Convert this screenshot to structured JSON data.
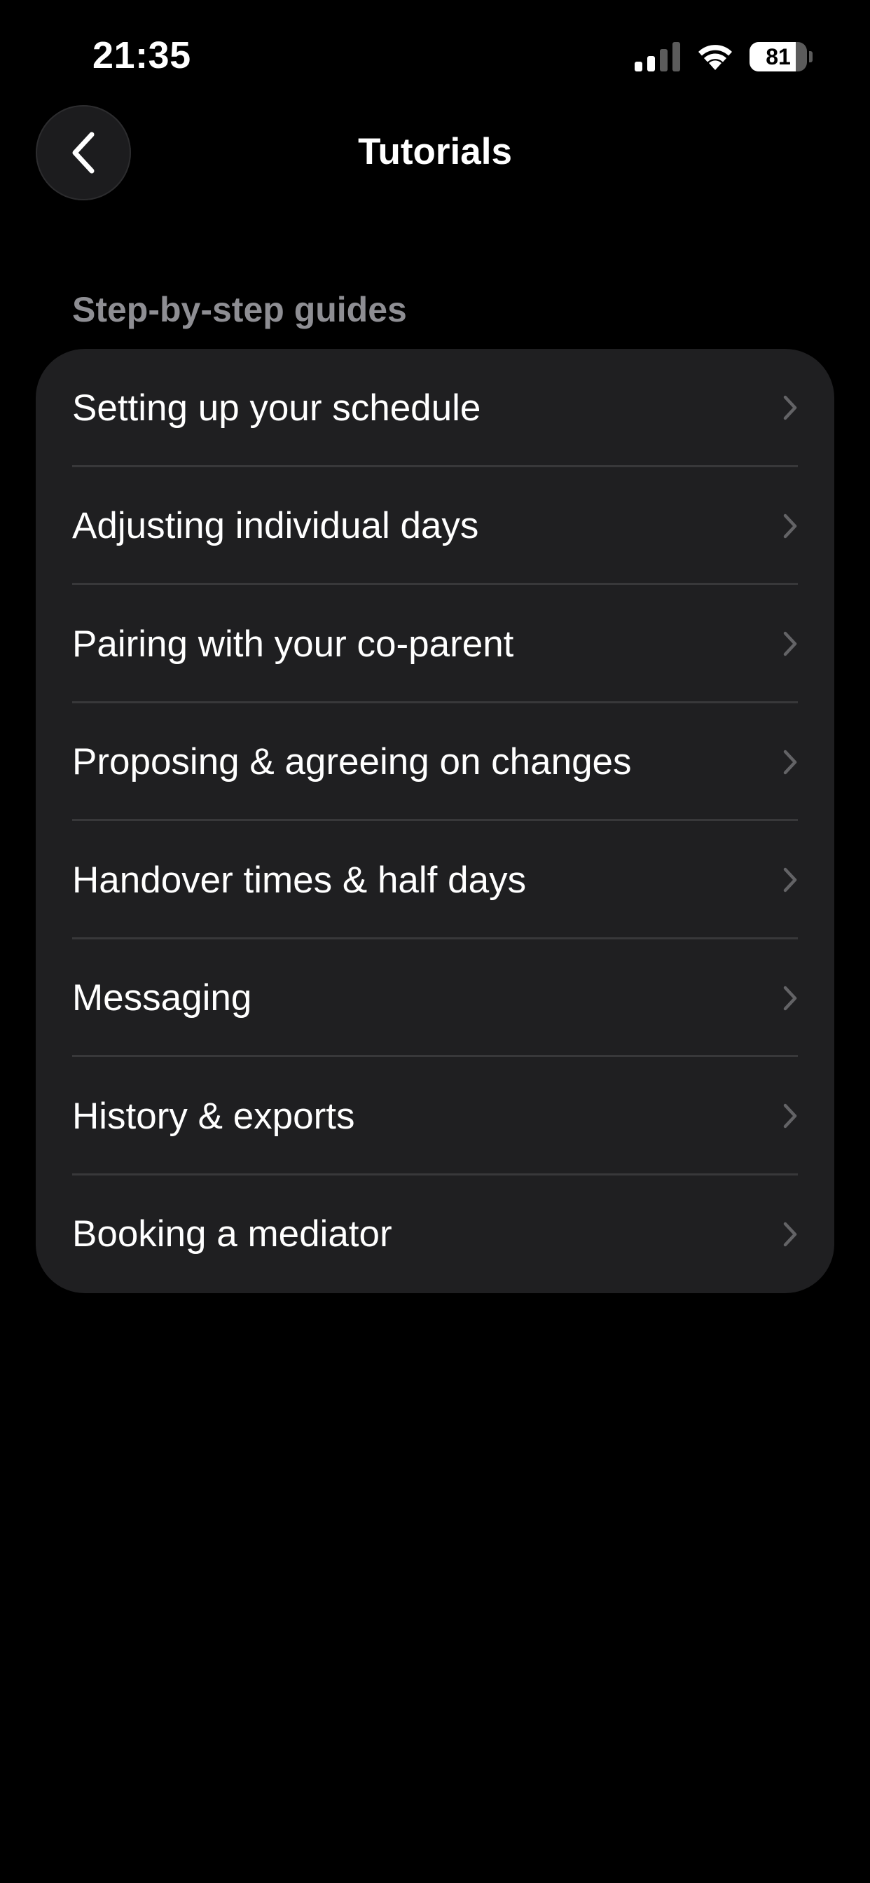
{
  "status_bar": {
    "time": "21:35",
    "battery_level": "81",
    "battery_fraction": 0.81,
    "icons": [
      "cellular-signal-icon",
      "wifi-icon",
      "battery-icon"
    ]
  },
  "nav": {
    "title": "Tutorials",
    "back_icon": "chevron-left-icon"
  },
  "section": {
    "header": "Step-by-step guides",
    "items": [
      {
        "label": "Setting up your schedule",
        "icon": "chevron-right-icon"
      },
      {
        "label": "Adjusting individual days",
        "icon": "chevron-right-icon"
      },
      {
        "label": "Pairing with your co-parent",
        "icon": "chevron-right-icon"
      },
      {
        "label": "Proposing & agreeing on changes",
        "icon": "chevron-right-icon"
      },
      {
        "label": "Handover times & half days",
        "icon": "chevron-right-icon"
      },
      {
        "label": "Messaging",
        "icon": "chevron-right-icon"
      },
      {
        "label": "History & exports",
        "icon": "chevron-right-icon"
      },
      {
        "label": "Booking a mediator",
        "icon": "chevron-right-icon"
      }
    ]
  },
  "colors": {
    "background": "#000000",
    "card": "#1f1f21",
    "separator": "#38383a",
    "secondary_text": "#8e8e93",
    "chevron": "#636366"
  }
}
